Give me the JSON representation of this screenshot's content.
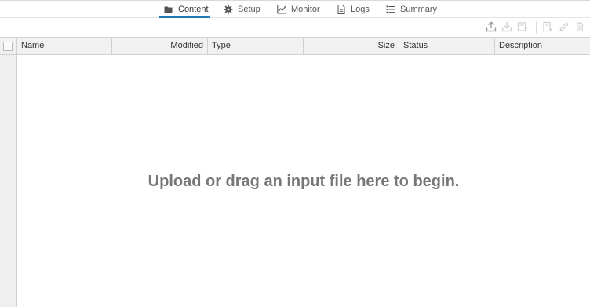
{
  "tabs": [
    {
      "label": "Content",
      "icon": "folder-icon",
      "active": true
    },
    {
      "label": "Setup",
      "icon": "gear-icon",
      "active": false
    },
    {
      "label": "Monitor",
      "icon": "line-chart-icon",
      "active": false
    },
    {
      "label": "Logs",
      "icon": "document-icon",
      "active": false
    },
    {
      "label": "Summary",
      "icon": "list-icon",
      "active": false
    }
  ],
  "toolbar": {
    "buttons": [
      "upload-icon",
      "download-icon",
      "import-icon",
      "details-icon",
      "edit-icon",
      "trash-icon"
    ]
  },
  "table": {
    "columns": [
      "Name",
      "Modified",
      "Type",
      "Size",
      "Status",
      "Description"
    ]
  },
  "empty_message": "Upload or drag an input file here to begin.",
  "colors": {
    "accent": "#1f7ab8",
    "header_bg": "#f1f1f1",
    "message": "#777777"
  }
}
